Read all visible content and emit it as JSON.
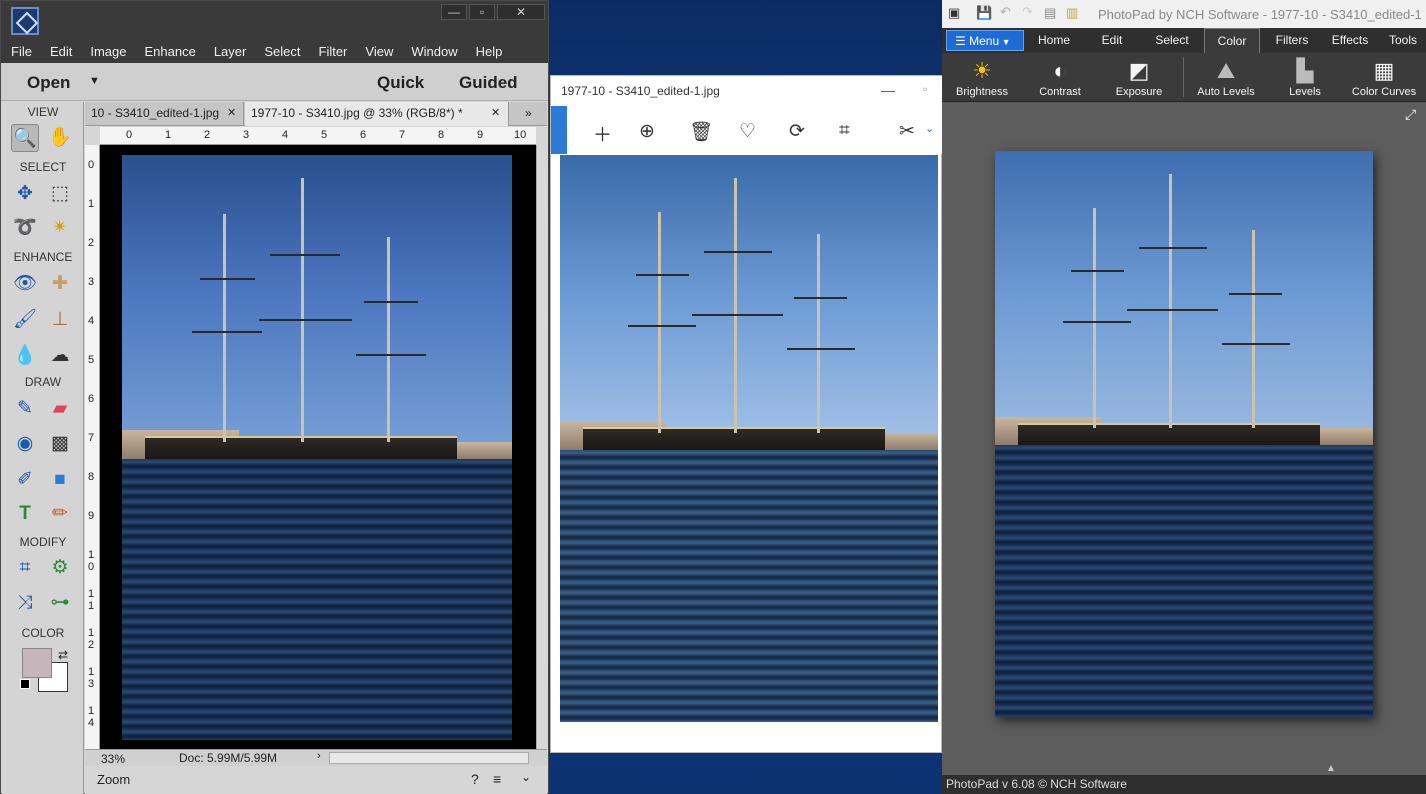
{
  "pse": {
    "menu": [
      "File",
      "Edit",
      "Image",
      "Enhance",
      "Layer",
      "Select",
      "Filter",
      "View",
      "Window",
      "Help"
    ],
    "open_label": "Open",
    "quick_label": "Quick",
    "guided_label": "Guided",
    "sections": {
      "view": "VIEW",
      "select": "SELECT",
      "enhance": "ENHANCE",
      "draw": "DRAW",
      "modify": "MODIFY",
      "color": "COLOR"
    },
    "tabs": [
      "10 - S3410_edited-1.jpg",
      "1977-10 - S3410.jpg @ 33% (RGB/8*) *"
    ],
    "ruler_h": [
      "0",
      "1",
      "2",
      "3",
      "4",
      "5",
      "6",
      "7",
      "8",
      "9",
      "10"
    ],
    "ruler_v": [
      "0",
      "1",
      "2",
      "3",
      "4",
      "5",
      "6",
      "7",
      "8",
      "9",
      "1 0",
      "1 1",
      "1 2",
      "1 3",
      "1 4"
    ],
    "zoom_status": "33%",
    "doc_status": "Doc: 5.99M/5.99M",
    "bottom_label": "Zoom",
    "colors": {
      "foreground": "#c7b5bc",
      "background": "#ffffff"
    }
  },
  "viewer": {
    "title": "1977-10 - S3410_edited-1.jpg",
    "toolbar_icons": [
      "add-icon",
      "zoom-in-icon",
      "delete-icon",
      "favorite-icon",
      "rotate-icon",
      "crop-icon",
      "edit-icon"
    ]
  },
  "photopad": {
    "title": "PhotoPad by NCH Software - 1977-10 - S3410_edited-1",
    "menu_label": "Menu",
    "tabs": [
      "Home",
      "Edit",
      "Select",
      "Color",
      "Filters",
      "Effects",
      "Tools"
    ],
    "active_tab": "Color",
    "ribbon": [
      "Brightness",
      "Contrast",
      "Exposure",
      "Auto Levels",
      "Levels",
      "Color Curves"
    ],
    "status": "PhotoPad v 6.08 © NCH Software"
  }
}
